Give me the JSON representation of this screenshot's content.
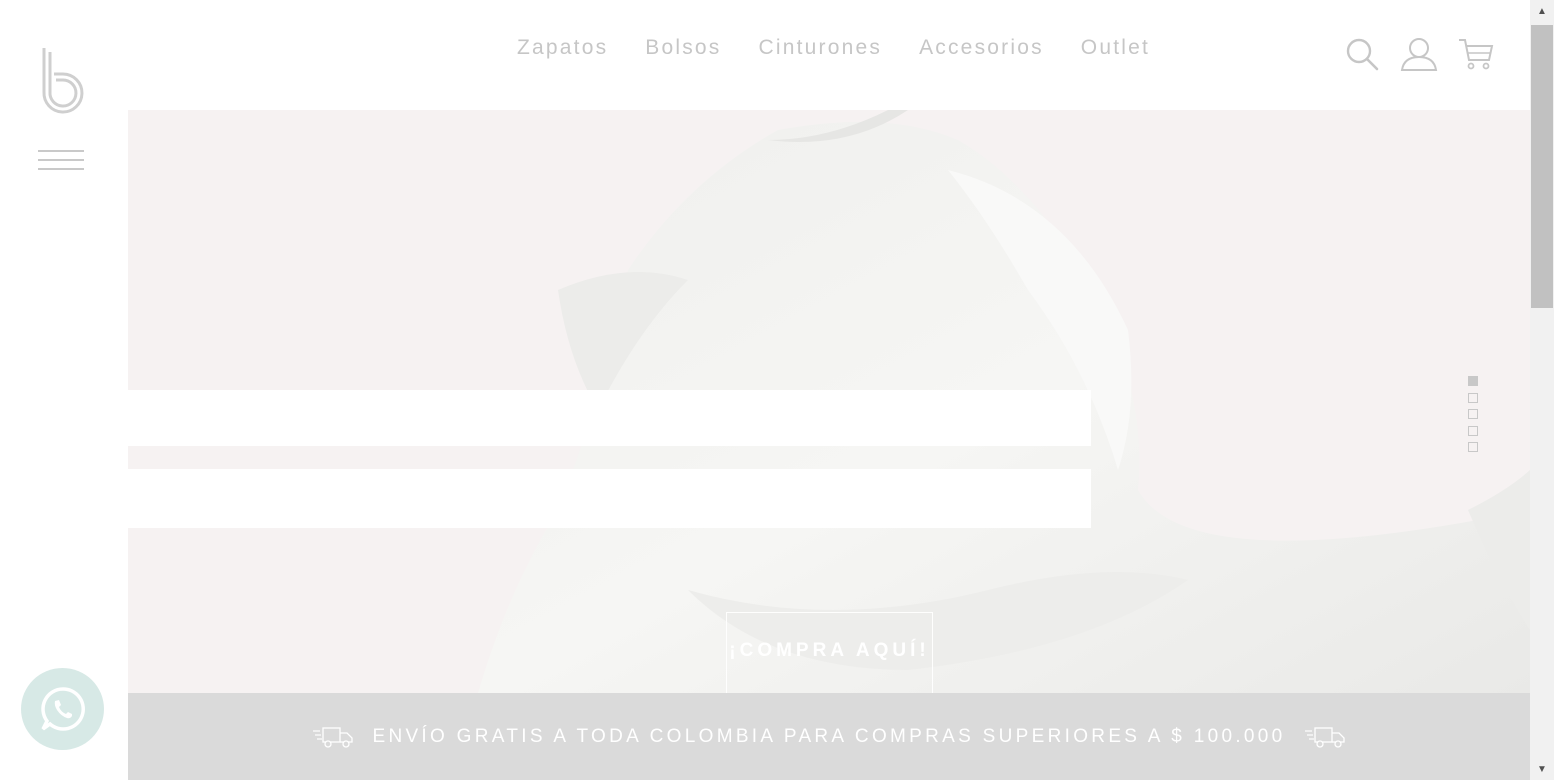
{
  "nav": {
    "items": [
      "Zapatos",
      "Bolsos",
      "Cinturones",
      "Accesorios",
      "Outlet"
    ]
  },
  "header_icons": [
    "search-icon",
    "user-icon",
    "cart-icon"
  ],
  "hero": {
    "cta_label": "¡COMPRA AQUÍ!",
    "slides_total": 5,
    "active_slide": 1
  },
  "shipping_banner": {
    "text": "ENVÍO GRATIS A TODA COLOMBIA PARA COMPRAS SUPERIORES A $ 100.000"
  },
  "colors": {
    "nav_text": "#c6c6c6",
    "hero_bg": "#f6f2f2",
    "banner_bg": "#dadada",
    "whatsapp_bg": "#d7e9e6"
  }
}
